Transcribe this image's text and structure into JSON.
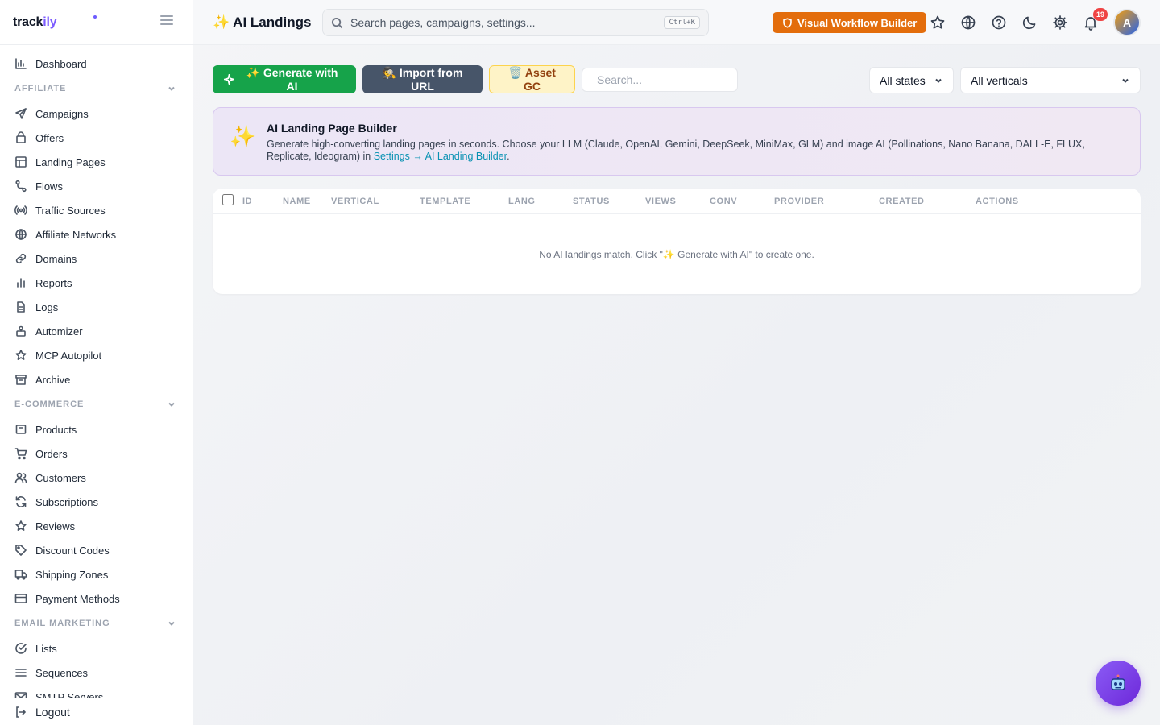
{
  "brand": {
    "prefix": "track",
    "suffix": "ily"
  },
  "nav": {
    "top": [
      {
        "label": "Dashboard",
        "icon": "bar-chart-icon"
      }
    ],
    "sections": [
      {
        "title": "AFFILIATE",
        "items": [
          {
            "label": "Campaigns",
            "icon": "send-icon"
          },
          {
            "label": "Offers",
            "icon": "package-icon"
          },
          {
            "label": "Landing Pages",
            "icon": "layout-icon"
          },
          {
            "label": "Flows",
            "icon": "flow-icon"
          },
          {
            "label": "Traffic Sources",
            "icon": "broadcast-icon"
          },
          {
            "label": "Affiliate Networks",
            "icon": "globe-icon"
          },
          {
            "label": "Domains",
            "icon": "link-icon"
          },
          {
            "label": "Reports",
            "icon": "bar-chart-icon"
          },
          {
            "label": "Logs",
            "icon": "file-icon"
          },
          {
            "label": "Automizer",
            "icon": "robot-icon"
          },
          {
            "label": "MCP Autopilot",
            "icon": "sparkle-star-icon"
          },
          {
            "label": "Archive",
            "icon": "archive-icon"
          }
        ]
      },
      {
        "title": "E-COMMERCE",
        "items": [
          {
            "label": "Products",
            "icon": "box-icon"
          },
          {
            "label": "Orders",
            "icon": "cart-icon"
          },
          {
            "label": "Customers",
            "icon": "users-icon"
          },
          {
            "label": "Subscriptions",
            "icon": "refresh-icon"
          },
          {
            "label": "Reviews",
            "icon": "star-icon"
          },
          {
            "label": "Discount Codes",
            "icon": "tag-icon"
          },
          {
            "label": "Shipping Zones",
            "icon": "truck-icon"
          },
          {
            "label": "Payment Methods",
            "icon": "credit-card-icon"
          }
        ]
      },
      {
        "title": "EMAIL MARKETING",
        "items": [
          {
            "label": "Lists",
            "icon": "check-circle-icon"
          },
          {
            "label": "Sequences",
            "icon": "list-icon"
          },
          {
            "label": "SMTP Servers",
            "icon": "mail-icon"
          }
        ]
      }
    ],
    "logout": "Logout"
  },
  "header": {
    "title": "AI Landings",
    "search_placeholder": "Search pages, campaigns, settings...",
    "search_shortcut": "Ctrl+K",
    "workflow_button": "Visual Workflow Builder",
    "notification_count": "19",
    "avatar_initial": "A"
  },
  "toolbar": {
    "generate_label": "✨ Generate with AI",
    "import_label": "🕵️ Import from URL",
    "asset_gc_label": "🗑️ Asset GC",
    "search_placeholder": "Search...",
    "states_value": "All states",
    "verticals_value": "All verticals"
  },
  "banner": {
    "title": "AI Landing Page Builder",
    "text": "Generate high-converting landing pages in seconds. Choose your LLM (Claude, OpenAI, Gemini, DeepSeek, MiniMax, GLM) and image AI (Pollinations, Nano Banana, DALL-E, FLUX, Replicate, Ideogram) in ",
    "link": "Settings → AI Landing Builder",
    "text_end": "."
  },
  "table": {
    "columns": [
      "ID",
      "NAME",
      "VERTICAL",
      "TEMPLATE",
      "LANG",
      "STATUS",
      "VIEWS",
      "CONV",
      "PROVIDER",
      "CREATED",
      "ACTIONS"
    ],
    "empty_message": "No AI landings match. Click \"✨ Generate with AI\" to create one."
  },
  "colors": {
    "accent": "#7c5cff",
    "generate": "#16a34a",
    "workflow": "#e36d0c",
    "link": "#0891b2"
  }
}
